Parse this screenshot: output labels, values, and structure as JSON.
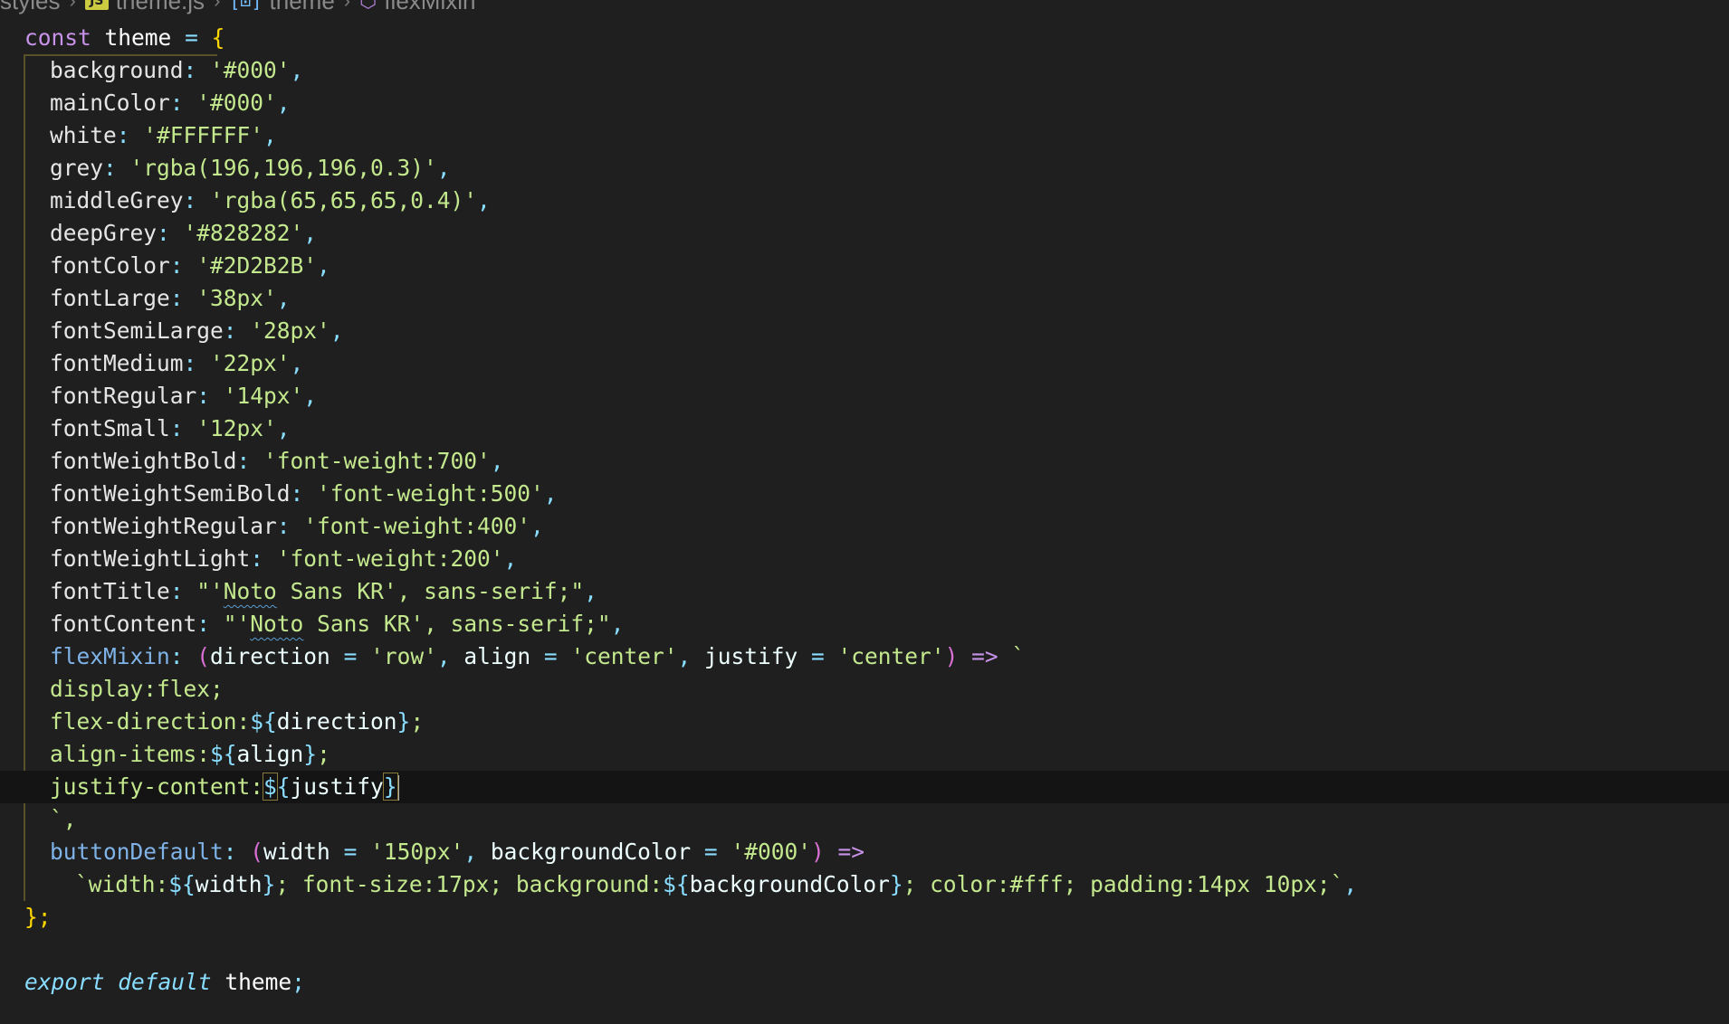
{
  "breadcrumb": {
    "items": [
      "styles",
      "theme.js",
      "theme",
      "flexMixin"
    ],
    "separator": ">",
    "icons": [
      "js-file-icon",
      "variable-icon",
      "method-icon"
    ]
  },
  "code": {
    "line1": {
      "keyword": "const",
      "name": "theme",
      "op": "=",
      "brace": "{"
    },
    "props": [
      {
        "key": "background",
        "value": "'#000'"
      },
      {
        "key": "mainColor",
        "value": "'#000'"
      },
      {
        "key": "white",
        "value": "'#FFFFFF'"
      },
      {
        "key": "grey",
        "value": "'rgba(196,196,196,0.3)'"
      },
      {
        "key": "middleGrey",
        "value": "'rgba(65,65,65,0.4)'"
      },
      {
        "key": "deepGrey",
        "value": "'#828282'"
      },
      {
        "key": "fontColor",
        "value": "'#2D2B2B'"
      },
      {
        "key": "fontLarge",
        "value": "'38px'"
      },
      {
        "key": "fontSemiLarge",
        "value": "'28px'"
      },
      {
        "key": "fontMedium",
        "value": "'22px'"
      },
      {
        "key": "fontRegular",
        "value": "'14px'"
      },
      {
        "key": "fontSmall",
        "value": "'12px'"
      },
      {
        "key": "fontWeightBold",
        "value": "'font-weight:700'"
      },
      {
        "key": "fontWeightSemiBold",
        "value": "'font-weight:500'"
      },
      {
        "key": "fontWeightRegular",
        "value": "'font-weight:400'"
      },
      {
        "key": "fontWeightLight",
        "value": "'font-weight:200'"
      }
    ],
    "fontTitle": {
      "key": "fontTitle",
      "q1": "\"'",
      "word": "Noto",
      "rest": " Sans KR', sans-serif;\""
    },
    "fontContent": {
      "key": "fontContent",
      "q1": "\"'",
      "word": "Noto",
      "rest": " Sans KR', sans-serif;\""
    },
    "flexMixin": {
      "key": "flexMixin",
      "p1": "direction",
      "v1": "'row'",
      "p2": "align",
      "v2": "'center'",
      "p3": "justify",
      "v3": "'center'",
      "arrow": "=>",
      "tick": "`"
    },
    "tplLines": [
      {
        "text": "display:flex;"
      },
      {
        "pre": "flex-direction:",
        "var": "direction",
        "post": ";"
      },
      {
        "pre": "align-items:",
        "var": "align",
        "post": ";"
      },
      {
        "pre": "justify-content:",
        "var": "justify",
        "post": ""
      }
    ],
    "tplEnd": "`,",
    "buttonDefault": {
      "key": "buttonDefault",
      "p1": "width",
      "v1": "'150px'",
      "p2": "backgroundColor",
      "v2": "'#000'",
      "arrow": "=>"
    },
    "buttonTpl": {
      "a": "`width:",
      "v1": "width",
      "b": "; font-size:17px; background:",
      "v2": "backgroundColor",
      "c": "; color:#fff; padding:14px 10px;`",
      "end": ","
    },
    "closing": "};",
    "export": {
      "kw1": "export",
      "kw2": "default",
      "name": "theme",
      "semi": ";"
    }
  }
}
